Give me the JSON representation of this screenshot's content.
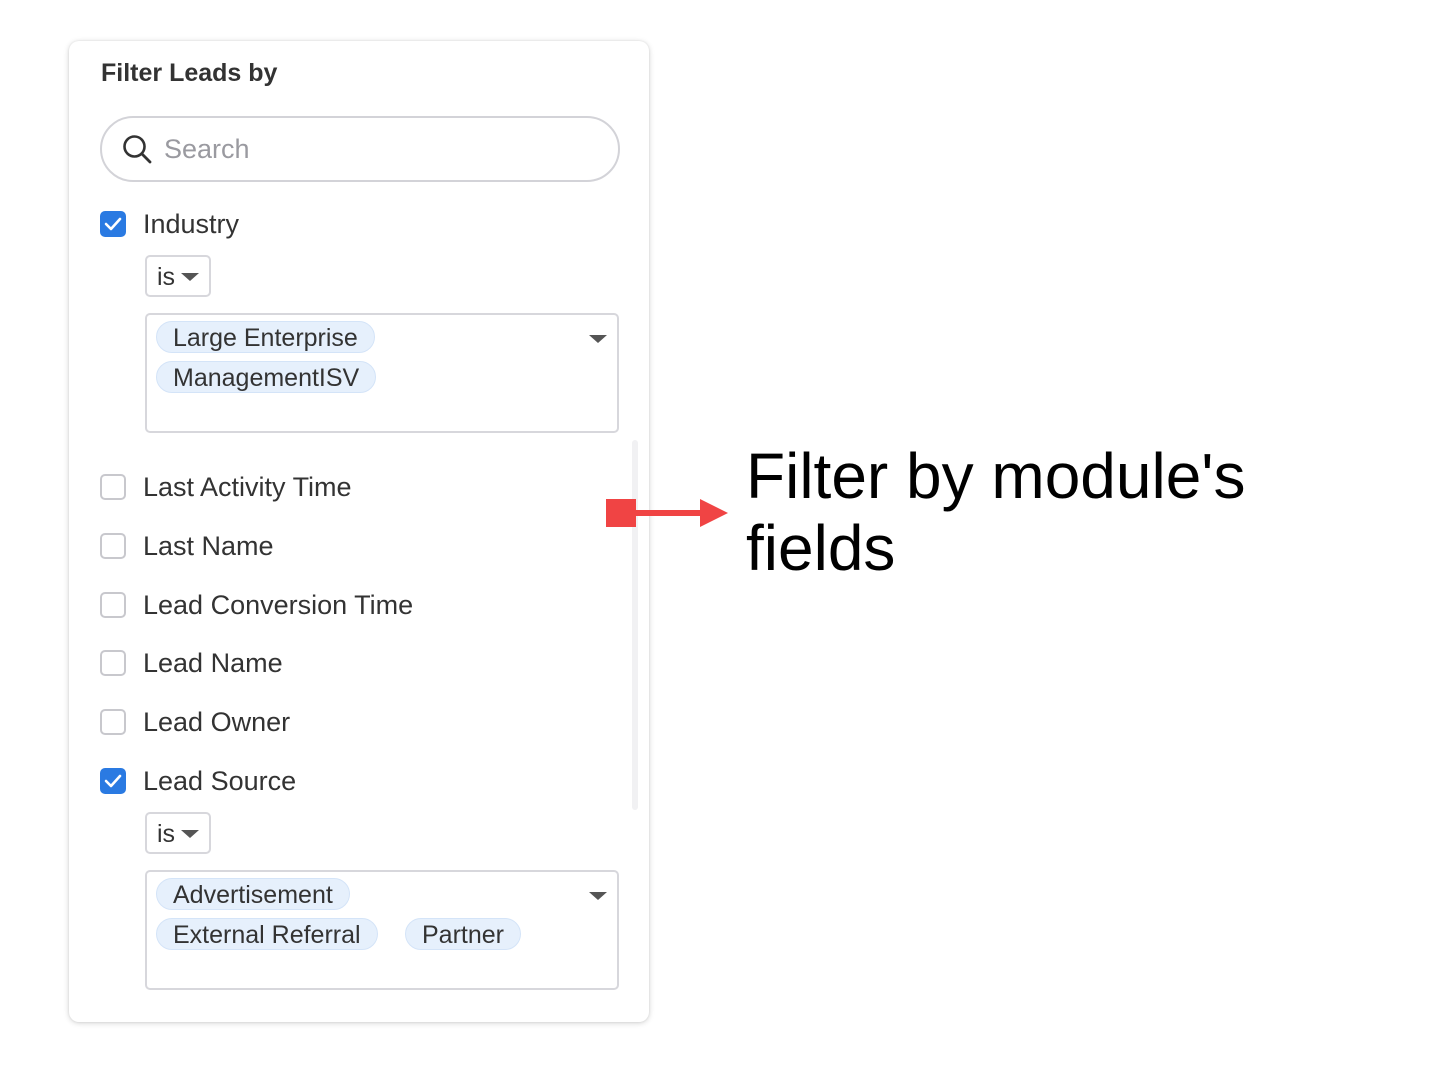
{
  "panel": {
    "title": "Filter Leads by",
    "search": {
      "placeholder": "Search",
      "value": ""
    }
  },
  "fields": {
    "industry": {
      "label": "Industry",
      "checked": true,
      "operator": "is",
      "values": [
        "Large Enterprise",
        "ManagementISV"
      ]
    },
    "last_activity_time": {
      "label": "Last Activity Time",
      "checked": false
    },
    "last_name": {
      "label": "Last Name",
      "checked": false
    },
    "lead_conversion_time": {
      "label": "Lead Conversion Time",
      "checked": false
    },
    "lead_name": {
      "label": "Lead Name",
      "checked": false
    },
    "lead_owner": {
      "label": "Lead Owner",
      "checked": false
    },
    "lead_source": {
      "label": "Lead Source",
      "checked": true,
      "operator": "is",
      "values": [
        "Advertisement",
        "External Referral",
        "Partner"
      ]
    }
  },
  "annotation": {
    "text": "Filter by module's fields",
    "arrow_color": "#f04444"
  },
  "colors": {
    "accent": "#2a7ae2",
    "chip_bg": "#e6f0fc"
  }
}
